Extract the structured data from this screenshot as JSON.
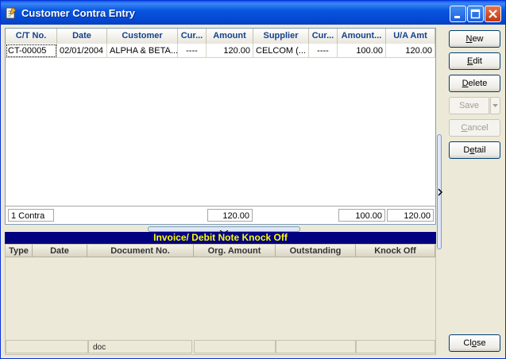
{
  "window": {
    "title": "Customer Contra Entry"
  },
  "grid": {
    "columns": [
      "C/T No.",
      "Date",
      "Customer",
      "Cur...",
      "Amount",
      "Supplier",
      "Cur...",
      "Amount...",
      "U/A Amt"
    ],
    "rows": [
      [
        "CT-00005",
        "02/01/2004",
        "ALPHA & BETA...",
        "----",
        "120.00",
        "CELCOM (...",
        "----",
        "100.00",
        "120.00"
      ]
    ],
    "footer": {
      "count": "1 Contra",
      "amount": "120.00",
      "supplier_amount": "100.00",
      "ua_amt": "120.00"
    }
  },
  "knockoff": {
    "title": "Invoice/ Debit Note Knock Off",
    "columns": [
      "Type",
      "Date",
      "Document No.",
      "Org. Amount",
      "Outstanding",
      "Knock Off"
    ],
    "footer_doc": "doc"
  },
  "buttons": {
    "new": {
      "pre": "",
      "u": "N",
      "post": "ew"
    },
    "edit": {
      "pre": "",
      "u": "E",
      "post": "dit"
    },
    "delete": {
      "pre": "",
      "u": "D",
      "post": "elete"
    },
    "save": {
      "pre": "",
      "u": "S",
      "post": "ave"
    },
    "cancel": {
      "pre": "",
      "u": "C",
      "post": "ancel"
    },
    "detail": {
      "pre": "D",
      "u": "e",
      "post": "tail"
    },
    "close": {
      "pre": "Cl",
      "u": "o",
      "post": "se"
    }
  }
}
